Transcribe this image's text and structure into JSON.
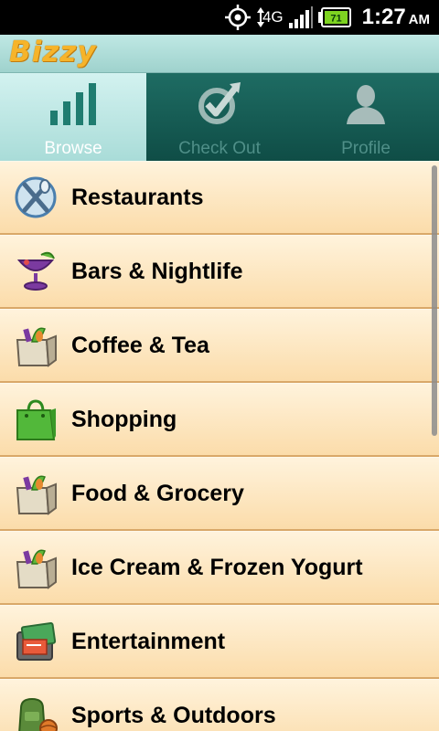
{
  "status_bar": {
    "network_type": "4G",
    "battery_level": "71",
    "time": "1:27",
    "ampm": "AM",
    "icons": [
      "gps-icon",
      "network-4g-icon",
      "signal-strength-icon",
      "battery-icon"
    ]
  },
  "app": {
    "name": "Bizzy",
    "colors": {
      "logo": "#f6b42a",
      "header": "#a9dcd8",
      "tab_bar": "#12564f",
      "list_item": "#fbdcaa"
    }
  },
  "tabs": [
    {
      "label": "Browse",
      "icon": "bar-chart-icon",
      "active": true
    },
    {
      "label": "Check Out",
      "icon": "checkmark-circle-icon",
      "active": false
    },
    {
      "label": "Profile",
      "icon": "person-silhouette-icon",
      "active": false
    }
  ],
  "categories": [
    {
      "label": "Restaurants",
      "icon": "fork-knife-icon"
    },
    {
      "label": "Bars & Nightlife",
      "icon": "cocktail-icon"
    },
    {
      "label": "Coffee & Tea",
      "icon": "grocery-bag-icon"
    },
    {
      "label": "Shopping",
      "icon": "shopping-bag-icon"
    },
    {
      "label": "Food & Grocery",
      "icon": "grocery-bag-icon"
    },
    {
      "label": "Ice Cream & Frozen Yogurt",
      "icon": "grocery-bag-icon"
    },
    {
      "label": "Entertainment",
      "icon": "tickets-icon"
    },
    {
      "label": "Sports & Outdoors",
      "icon": "sports-gear-icon"
    }
  ]
}
